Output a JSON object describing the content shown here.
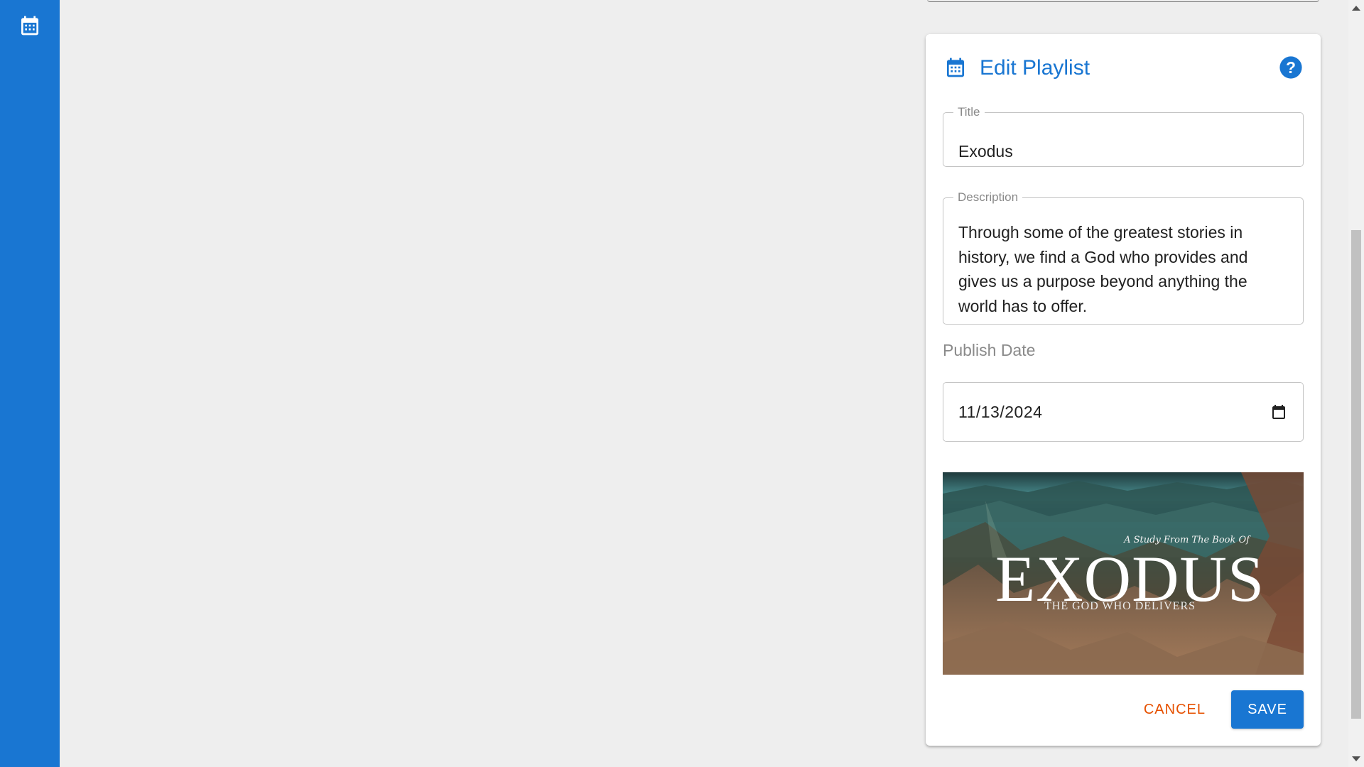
{
  "sidebar": {
    "icon": "calendar-icon",
    "color": "#1976d2"
  },
  "dialog": {
    "title": "Edit Playlist",
    "title_icon": "calendar-icon",
    "help_icon": "help-circle-icon",
    "accent_color": "#1976d2"
  },
  "form": {
    "title_label": "Title",
    "title_value": "Exodus",
    "description_label": "Description",
    "description_value": "Through some of the greatest stories in history, we find a God who provides and gives us a purpose beyond anything the world has to offer.",
    "publish_date_label": "Publish Date",
    "publish_date_value": "11/13/2024",
    "date_picker_icon": "calendar-outline-icon"
  },
  "cover_image": {
    "kicker": "A Study From The Book Of",
    "title": "EXODUS",
    "subtitle": "THE GOD WHO DELIVERS"
  },
  "actions": {
    "cancel_label": "CANCEL",
    "save_label": "SAVE",
    "cancel_color": "#e65100",
    "save_color": "#1976d2"
  }
}
